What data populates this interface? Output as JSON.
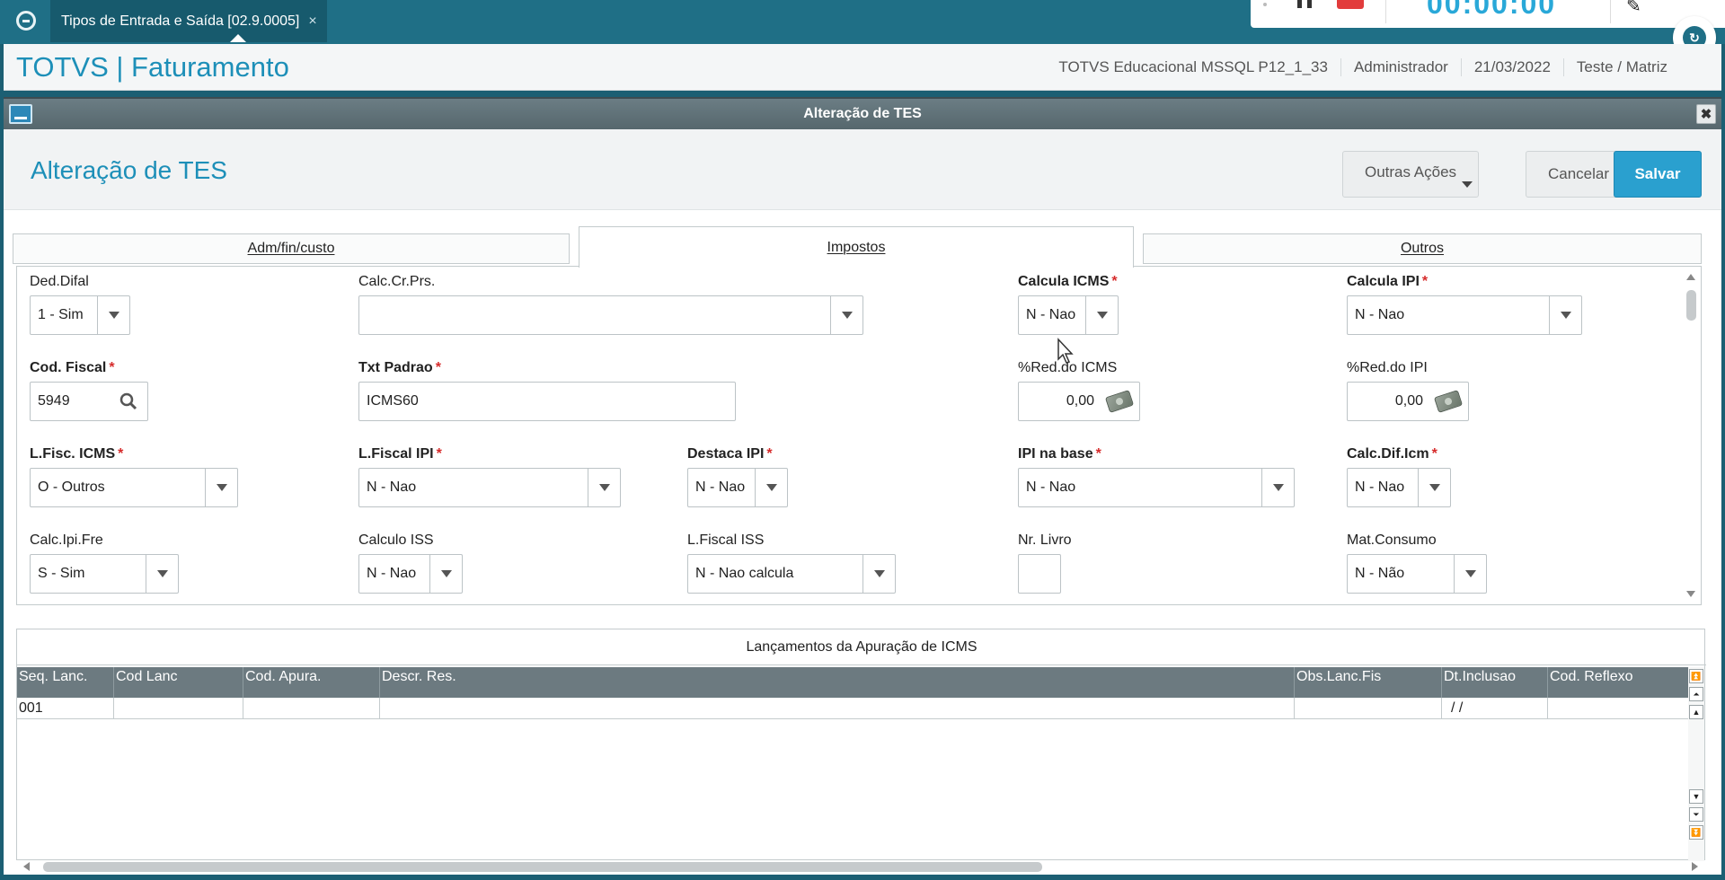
{
  "app_tab": {
    "title": "Tipos de Entrada e Saída [02.9.0005]",
    "close": "×"
  },
  "recorder": {
    "timer": "00:00:00"
  },
  "module": {
    "title": "TOTVS | Faturamento",
    "environment": "TOTVS Educacional MSSQL P12_1_33",
    "user": "Administrador",
    "date": "21/03/2022",
    "branch": "Teste / Matriz"
  },
  "dialog": {
    "title": "Alteração de TES",
    "close": "✖",
    "page_title": "Alteração de TES",
    "buttons": {
      "outras": "Outras Ações",
      "cancelar": "Cancelar",
      "salvar": "Salvar"
    }
  },
  "tabs": {
    "adm": "Adm/fin/custo",
    "impostos": "Impostos",
    "outros": "Outros"
  },
  "fields": {
    "ded_difal": {
      "label": "Ded.Difal",
      "value": "1 - Sim"
    },
    "calc_cr_prs": {
      "label": "Calc.Cr.Prs.",
      "value": ""
    },
    "calcula_icms": {
      "label": "Calcula ICMS",
      "value": "N - Nao"
    },
    "calcula_ipi": {
      "label": "Calcula IPI",
      "value": "N - Nao"
    },
    "cod_fiscal": {
      "label": "Cod. Fiscal",
      "value": "5949"
    },
    "txt_padrao": {
      "label": "Txt Padrao",
      "value": "ICMS60"
    },
    "red_icms": {
      "label": "%Red.do ICMS",
      "value": "0,00"
    },
    "red_ipi": {
      "label": "%Red.do IPI",
      "value": "0,00"
    },
    "lfisc_icms": {
      "label": "L.Fisc. ICMS",
      "value": "O - Outros"
    },
    "lfiscal_ipi": {
      "label": "L.Fiscal IPI",
      "value": "N - Nao"
    },
    "destaca_ipi": {
      "label": "Destaca IPI",
      "value": "N - Nao"
    },
    "ipi_na_base": {
      "label": "IPI na base",
      "value": "N - Nao"
    },
    "calc_dif_icm": {
      "label": "Calc.Dif.Icm",
      "value": "N - Nao"
    },
    "calc_ipi_fre": {
      "label": "Calc.Ipi.Fre",
      "value": "S - Sim"
    },
    "calculo_iss": {
      "label": "Calculo ISS",
      "value": "N - Nao"
    },
    "lfiscal_iss": {
      "label": "L.Fiscal ISS",
      "value": "N - Nao calcula"
    },
    "nr_livro": {
      "label": "Nr. Livro",
      "value": ""
    },
    "mat_consumo": {
      "label": "Mat.Consumo",
      "value": "N - Não"
    }
  },
  "grid": {
    "title": "Lançamentos da Apuração de ICMS",
    "columns": [
      "Seq. Lanc.",
      "Cod Lanc",
      "Cod. Apura.",
      "Descr. Res.",
      "Obs.Lanc.Fis",
      "Dt.Inclusao",
      "Cod. Reflexo"
    ],
    "rows": [
      [
        "001",
        "",
        "",
        "",
        "",
        " /  /",
        ""
      ]
    ]
  }
}
